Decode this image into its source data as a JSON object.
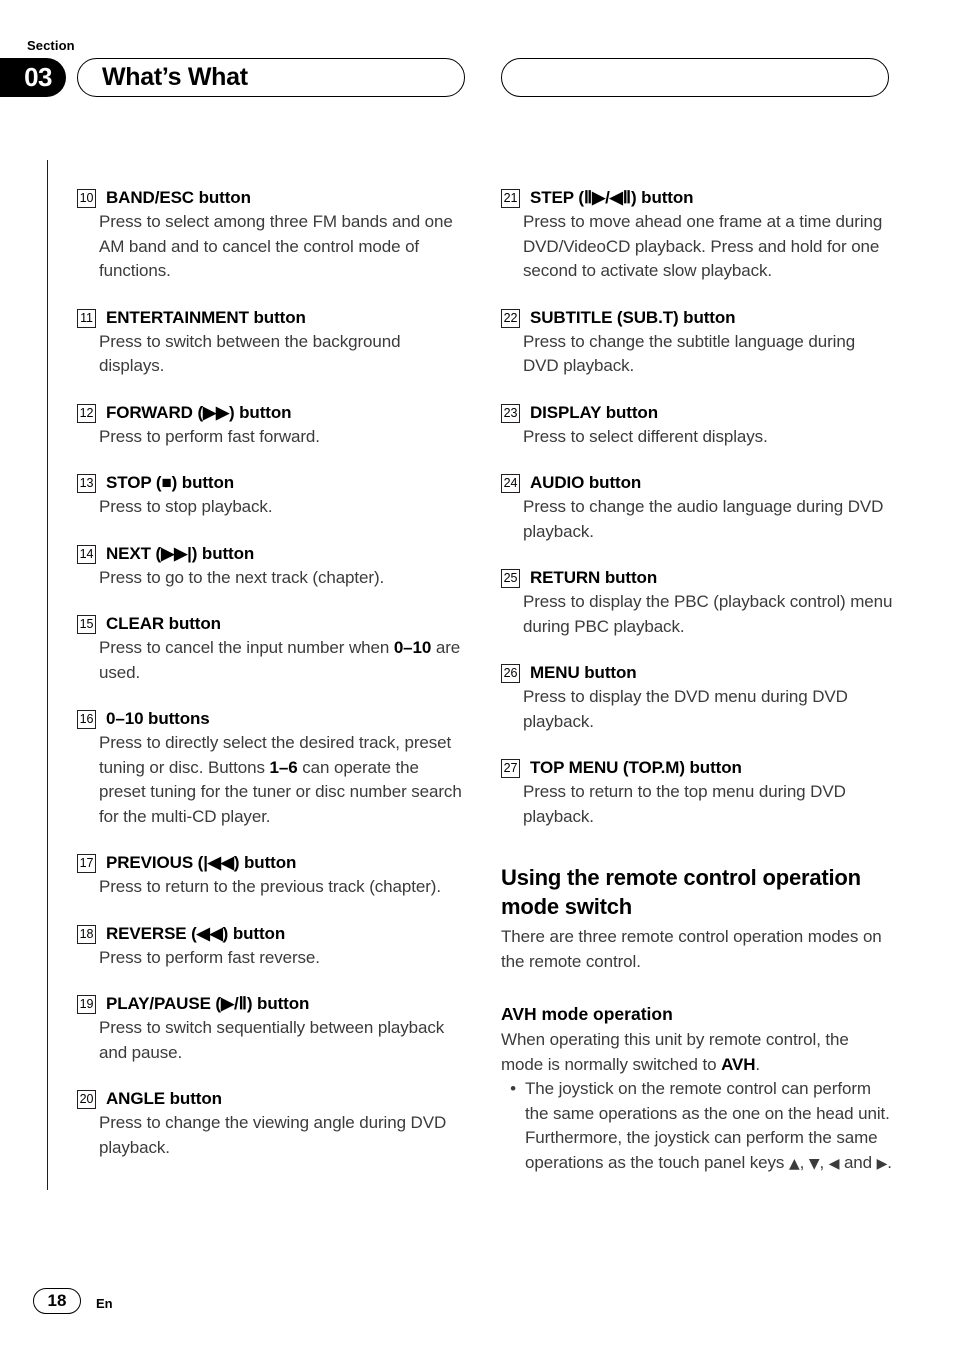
{
  "header": {
    "section_label": "Section",
    "section_number": "03",
    "title": "What’s What",
    "right_pill_title": ""
  },
  "left_column": {
    "entries": [
      {
        "number": "10",
        "title": "BAND/ESC button",
        "body": "Press to select among three FM bands and one AM band and to cancel the control mode of functions."
      },
      {
        "number": "11",
        "title": "ENTERTAINMENT button",
        "body": "Press to switch between the background displays."
      },
      {
        "number": "12",
        "title": "FORWARD (▶▶) button",
        "body": "Press to perform fast forward."
      },
      {
        "number": "13",
        "title": "STOP (■) button",
        "body": "Press to stop playback."
      },
      {
        "number": "14",
        "title": "NEXT (▶▶|) button",
        "body": "Press to go to the next track (chapter)."
      },
      {
        "number": "15",
        "title": "CLEAR button",
        "body_pre": "Press to cancel the input number when ",
        "body_bold": "0–10",
        "body_post": " are used."
      },
      {
        "number": "16",
        "title": "0–10 buttons",
        "body_pre": "Press to directly select the desired track, preset tuning or disc. Buttons ",
        "body_bold": "1–6",
        "body_post": " can operate the preset tuning for the tuner or disc number search for the multi-CD player."
      },
      {
        "number": "17",
        "title": "PREVIOUS (|◀◀) button",
        "body": "Press to return to the previous track (chapter)."
      },
      {
        "number": "18",
        "title": "REVERSE (◀◀) button",
        "body": "Press to perform fast reverse."
      },
      {
        "number": "19",
        "title": "PLAY/PAUSE (▶/Ⅱ) button",
        "body": "Press to switch sequentially between playback and pause."
      },
      {
        "number": "20",
        "title": "ANGLE button",
        "body": "Press to change the viewing angle during DVD playback."
      }
    ]
  },
  "right_column": {
    "entries": [
      {
        "number": "21",
        "title": "STEP (Ⅱ▶/◀Ⅱ) button",
        "body": "Press to move ahead one frame at a time during DVD/VideoCD playback. Press and hold for one second to activate slow playback."
      },
      {
        "number": "22",
        "title": "SUBTITLE (SUB.T) button",
        "body": "Press to change the subtitle language during DVD playback."
      },
      {
        "number": "23",
        "title": "DISPLAY button",
        "body": "Press to select different displays."
      },
      {
        "number": "24",
        "title": "AUDIO button",
        "body": "Press to change the audio language during DVD playback."
      },
      {
        "number": "25",
        "title": "RETURN button",
        "body": "Press to display the PBC (playback control) menu during PBC playback."
      },
      {
        "number": "26",
        "title": "MENU button",
        "body": "Press to display the DVD menu during DVD playback."
      },
      {
        "number": "27",
        "title": "TOP MENU (TOP.M) button",
        "body": "Press to return to the top menu during DVD playback."
      }
    ],
    "section_heading": "Using the remote control operation mode switch",
    "section_intro": "There are three remote control operation modes on the remote control.",
    "sub_heading": "AVH mode operation",
    "sub_intro_pre": "When operating this unit by remote control, the mode is normally switched to ",
    "sub_intro_bold": "AVH",
    "sub_intro_post": ".",
    "bullet_marker": "•",
    "bullet_text_pre": "The joystick on the remote control can perform the same operations as the one on the head unit. Furthermore, the joystick can perform the same operations as the touch panel keys ",
    "bullet_arrow_up": "▲",
    "bullet_sep1": ", ",
    "bullet_arrow_down": "▼",
    "bullet_sep2": ", ",
    "bullet_arrow_left": "◀",
    "bullet_and": " and ",
    "bullet_arrow_right": "▶",
    "bullet_text_post": "."
  },
  "footer": {
    "page_number": "18",
    "language": "En"
  }
}
